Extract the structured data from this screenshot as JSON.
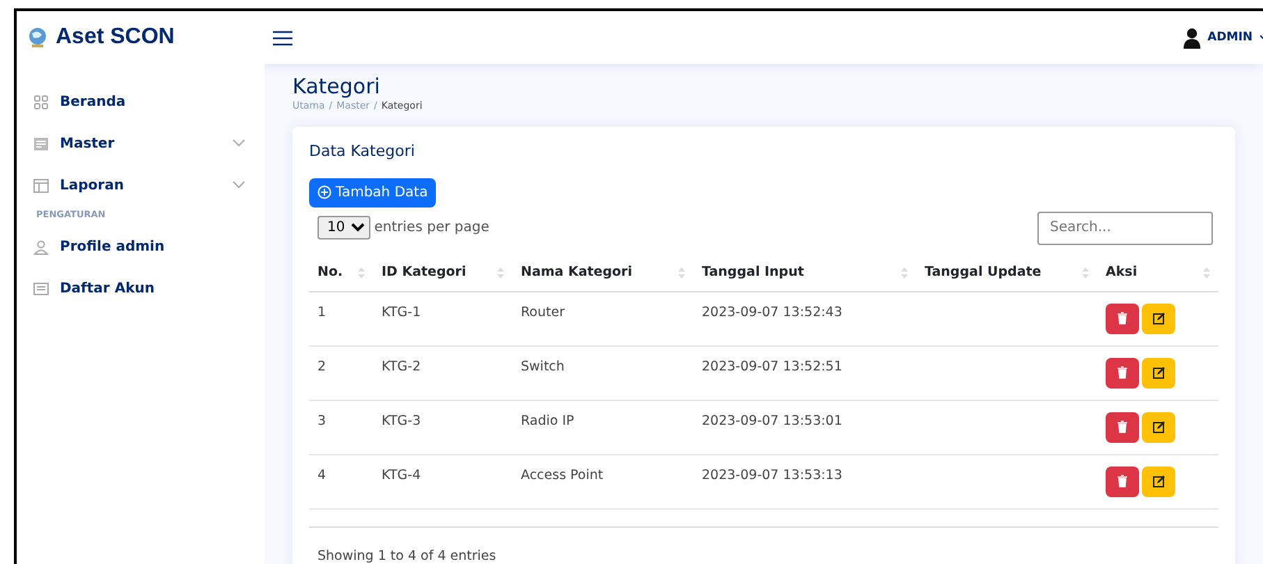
{
  "brand": {
    "title": "Aset SCON"
  },
  "user": {
    "name": "ADMIN"
  },
  "sidebar": {
    "items": [
      {
        "kind": "link",
        "label": "Beranda"
      },
      {
        "kind": "dropdown",
        "label": "Master"
      },
      {
        "kind": "dropdown",
        "label": "Laporan"
      },
      {
        "kind": "heading",
        "label": "PENGATURAN"
      },
      {
        "kind": "link",
        "label": "Profile admin"
      },
      {
        "kind": "link",
        "label": "Daftar Akun"
      }
    ]
  },
  "page": {
    "title": "Kategori",
    "breadcrumb": [
      "Utama",
      "Master",
      "Kategori"
    ],
    "breadcrumb_separator": "/"
  },
  "card": {
    "title": "Data Kategori",
    "add_button": "Tambah Data",
    "per_page": "10",
    "per_page_label": "entries per page",
    "search_placeholder": "Search...",
    "columns": [
      "No.",
      "ID Kategori",
      "Nama Kategori",
      "Tanggal Input",
      "Tanggal Update",
      "Aksi"
    ],
    "rows": [
      [
        "1",
        "KTG-1",
        "Router",
        "2023-09-07 13:52:43"
      ],
      [
        "2",
        "KTG-2",
        "Switch",
        "2023-09-07 13:52:51"
      ],
      [
        "3",
        "KTG-3",
        "Radio IP",
        "2023-09-07 13:53:01"
      ],
      [
        "4",
        "KTG-4",
        "Access Point",
        "2023-09-07 13:53:13"
      ]
    ],
    "info": "Showing 1 to 4 of 4 entries"
  }
}
